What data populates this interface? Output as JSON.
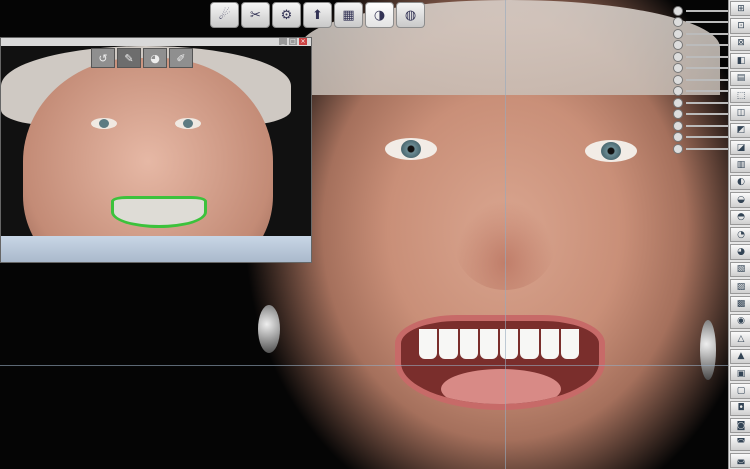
{
  "toolbar": {
    "buttons": [
      {
        "name": "tool-1-icon",
        "glyph": "☄"
      },
      {
        "name": "tool-2-icon",
        "glyph": "✂"
      },
      {
        "name": "tool-3-icon",
        "glyph": "⚙"
      },
      {
        "name": "tool-4-icon",
        "glyph": "⬆"
      },
      {
        "name": "tool-5-icon",
        "glyph": "▦"
      },
      {
        "name": "tooth-icon",
        "glyph": "◑"
      },
      {
        "name": "tool-7-icon",
        "glyph": "◍"
      }
    ]
  },
  "thumbnail": {
    "window_buttons": [
      "_",
      "□",
      "×"
    ],
    "tools": [
      {
        "name": "undo-icon",
        "glyph": "↺"
      },
      {
        "name": "pen-icon",
        "glyph": "✎"
      },
      {
        "name": "tooth-icon",
        "glyph": "◕"
      },
      {
        "name": "brush-icon",
        "glyph": "✐"
      }
    ]
  },
  "sliders": [
    {
      "name": "slider-1"
    },
    {
      "name": "slider-2"
    },
    {
      "name": "slider-3"
    },
    {
      "name": "slider-4"
    },
    {
      "name": "slider-5"
    },
    {
      "name": "slider-6"
    },
    {
      "name": "slider-7"
    },
    {
      "name": "slider-8"
    },
    {
      "name": "slider-9"
    },
    {
      "name": "slider-10"
    },
    {
      "name": "slider-11"
    },
    {
      "name": "slider-12"
    },
    {
      "name": "slider-13"
    }
  ],
  "right_toolbar": [
    {
      "glyph": "⊞"
    },
    {
      "glyph": "⊡"
    },
    {
      "glyph": "⊠"
    },
    {
      "glyph": "◧"
    },
    {
      "glyph": "▤"
    },
    {
      "glyph": "⬚"
    },
    {
      "glyph": "◫"
    },
    {
      "glyph": "◩"
    },
    {
      "glyph": "◪"
    },
    {
      "glyph": "▥"
    },
    {
      "glyph": "◐"
    },
    {
      "glyph": "◒"
    },
    {
      "glyph": "◓"
    },
    {
      "glyph": "◔"
    },
    {
      "glyph": "◕"
    },
    {
      "glyph": "▧"
    },
    {
      "glyph": "▨"
    },
    {
      "glyph": "▩"
    },
    {
      "glyph": "◉"
    },
    {
      "glyph": "△"
    },
    {
      "glyph": "▲"
    },
    {
      "glyph": "▣"
    },
    {
      "glyph": "▢"
    },
    {
      "glyph": "◘"
    },
    {
      "glyph": "◙"
    },
    {
      "glyph": "◚"
    },
    {
      "glyph": "◛"
    }
  ]
}
